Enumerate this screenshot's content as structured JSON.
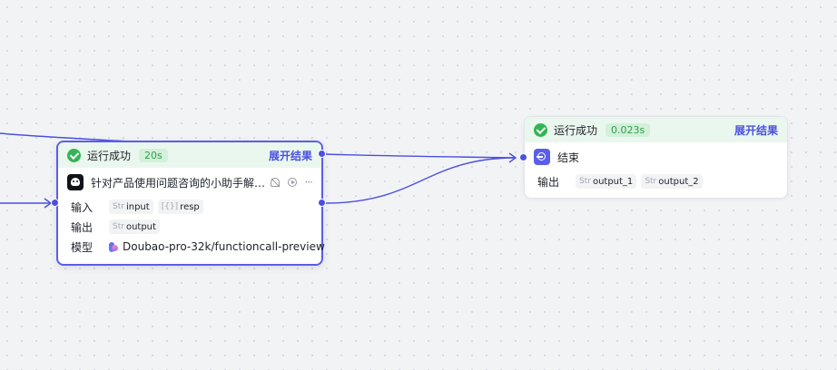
{
  "colors": {
    "accent": "#4a50e0",
    "success": "#35b455",
    "success_bg": "#eaf7ee",
    "edge": "#4a50e0"
  },
  "llm_node": {
    "status_icon": "check-circle-icon",
    "status_text": "运行成功",
    "duration": "20s",
    "expand_label": "展开结果",
    "icon": "llm-robot-icon",
    "title": "针对产品使用问题咨询的小助手解…",
    "toolbar": [
      "bell-off-icon",
      "play-icon",
      "more-icon"
    ],
    "input_label": "输入",
    "inputs": [
      {
        "type": "Str",
        "name": "input"
      },
      {
        "type": "[{}]",
        "name": "resp"
      }
    ],
    "output_label": "输出",
    "outputs": [
      {
        "type": "Str",
        "name": "output"
      }
    ],
    "model_label": "模型",
    "model_icon": "doubao-logo-icon",
    "model_name": "Doubao-pro-32k/functioncall-preview"
  },
  "end_node": {
    "status_icon": "check-circle-icon",
    "status_text": "运行成功",
    "duration": "0.023s",
    "expand_label": "展开结果",
    "icon": "end-icon",
    "title": "结束",
    "output_label": "输出",
    "outputs": [
      {
        "type": "Str",
        "name": "output_1"
      },
      {
        "type": "Str",
        "name": "output_2"
      }
    ]
  }
}
